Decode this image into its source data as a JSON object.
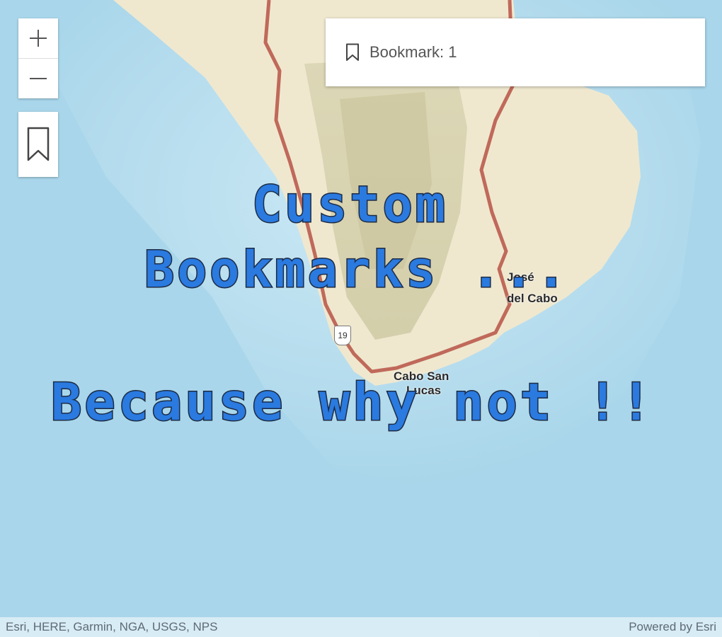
{
  "map": {
    "zoom_in_label": "+",
    "zoom_out_label": "−",
    "places": {
      "san_jose": "del Cabo",
      "san_jose_partial": "José",
      "cabo_san_lucas_top": "Cabo San",
      "cabo_san_lucas_bottom": "Lucas"
    },
    "road_shield": "19",
    "attribution": "Esri, HERE, Garmin, NGA, USGS, NPS",
    "powered_by": "Powered by Esri"
  },
  "bookmarks": {
    "items": [
      {
        "label": "Bookmark: 1"
      }
    ]
  },
  "overlay": {
    "line1": "Custom",
    "line2": "Bookmarks ...",
    "line3": "Because why not !!"
  },
  "colors": {
    "water": "#a9d6ea",
    "land": "#efe8cf",
    "boundary": "#c0695a",
    "overlay_text": "#2a7ae0"
  },
  "icons": {
    "zoom_in": "plus-icon",
    "zoom_out": "minus-icon",
    "bookmarks": "bookmark-icon"
  }
}
